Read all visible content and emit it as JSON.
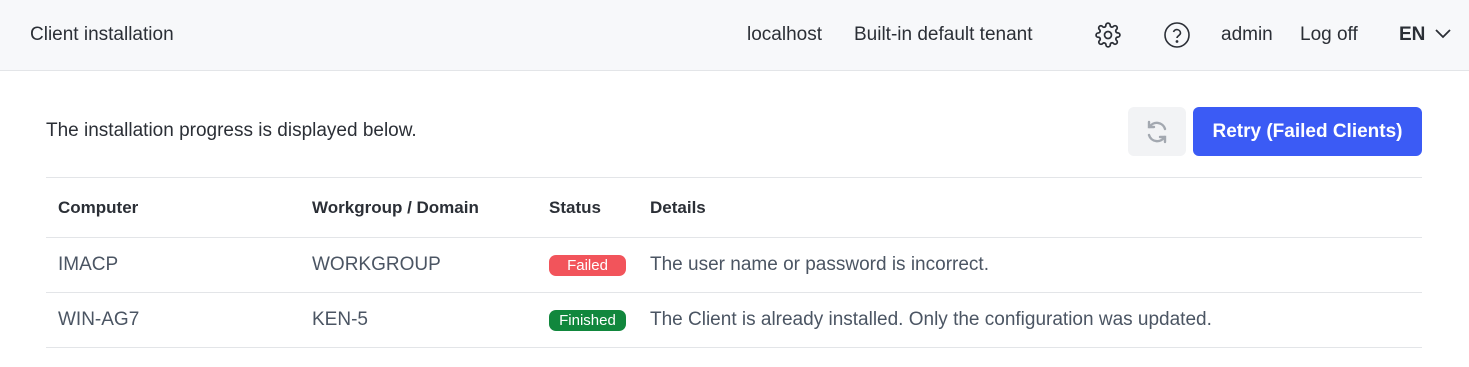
{
  "header": {
    "title": "Client installation",
    "host": "localhost",
    "tenant": "Built-in default tenant",
    "user": "admin",
    "logoff": "Log off",
    "language": "EN"
  },
  "main": {
    "intro": "The installation progress is displayed below.",
    "retry_label": "Retry (Failed Clients)"
  },
  "table": {
    "columns": [
      "Computer",
      "Workgroup / Domain",
      "Status",
      "Details"
    ],
    "rows": [
      {
        "computer": "IMACP",
        "domain": "WORKGROUP",
        "status": "Failed",
        "status_color": "#f2545b",
        "details": "The user name or password is incorrect."
      },
      {
        "computer": "WIN-AG7",
        "domain": "KEN-5",
        "status": "Finished",
        "status_color": "#11873d",
        "details": "The Client is already installed. Only the configuration was updated."
      }
    ]
  },
  "colors": {
    "accent": "#3b5bf5",
    "failed": "#f2545b",
    "finished": "#11873d"
  },
  "icons": [
    "gear-icon",
    "help-icon",
    "chevron-down-icon",
    "refresh-icon"
  ]
}
